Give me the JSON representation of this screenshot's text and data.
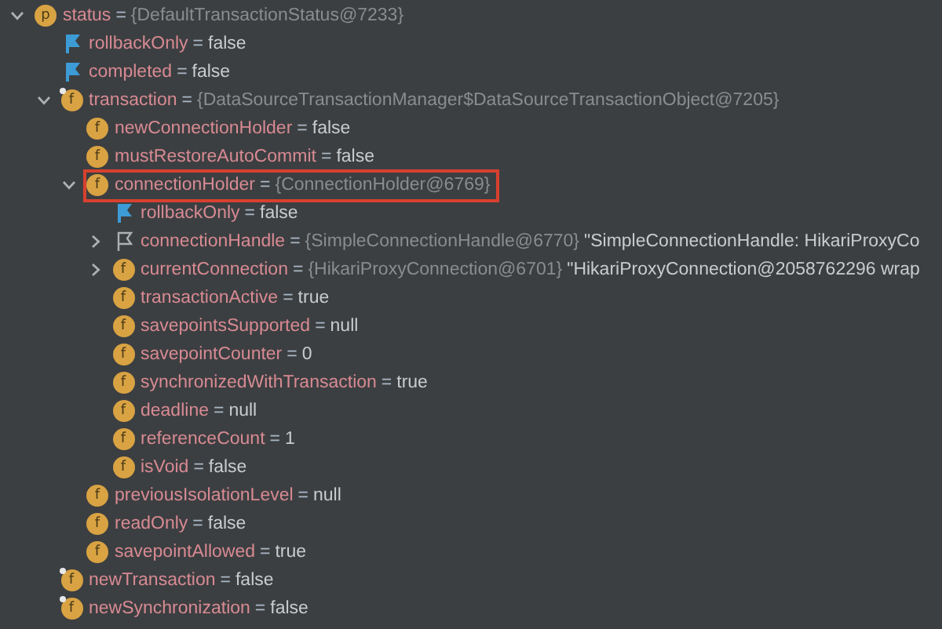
{
  "tree": [
    {
      "kind": "param",
      "badge": "p",
      "name": "status",
      "operator": "=",
      "ref": "{DefaultTransactionStatus@7233}",
      "expanded": true,
      "children": [
        {
          "kind": "flag",
          "name": "rollbackOnly",
          "operator": "=",
          "value": "false"
        },
        {
          "kind": "flag",
          "name": "completed",
          "operator": "=",
          "value": "false"
        },
        {
          "kind": "field-final",
          "badge": "f",
          "name": "transaction",
          "operator": "=",
          "ref": "{DataSourceTransactionManager$DataSourceTransactionObject@7205}",
          "expanded": true,
          "children": [
            {
              "kind": "field",
              "badge": "f",
              "name": "newConnectionHolder",
              "operator": "=",
              "value": "false"
            },
            {
              "kind": "field",
              "badge": "f",
              "name": "mustRestoreAutoCommit",
              "operator": "=",
              "value": "false"
            },
            {
              "kind": "field",
              "badge": "f",
              "name": "connectionHolder",
              "operator": "=",
              "ref": "{ConnectionHolder@6769}",
              "expanded": true,
              "highlighted": true,
              "children": [
                {
                  "kind": "flag",
                  "name": "rollbackOnly",
                  "operator": "=",
                  "value": "false"
                },
                {
                  "kind": "flag-outline",
                  "name": "connectionHandle",
                  "operator": "=",
                  "ref": "{SimpleConnectionHandle@6770}",
                  "detail": "\"SimpleConnectionHandle: HikariProxyCo",
                  "expanded": false
                },
                {
                  "kind": "field",
                  "badge": "f",
                  "name": "currentConnection",
                  "operator": "=",
                  "ref": "{HikariProxyConnection@6701}",
                  "detail": "\"HikariProxyConnection@2058762296 wrap",
                  "expanded": false
                },
                {
                  "kind": "field",
                  "badge": "f",
                  "name": "transactionActive",
                  "operator": "=",
                  "value": "true"
                },
                {
                  "kind": "field",
                  "badge": "f",
                  "name": "savepointsSupported",
                  "operator": "=",
                  "value": "null"
                },
                {
                  "kind": "field",
                  "badge": "f",
                  "name": "savepointCounter",
                  "operator": "=",
                  "value": "0"
                },
                {
                  "kind": "field",
                  "badge": "f",
                  "name": "synchronizedWithTransaction",
                  "operator": "=",
                  "value": "true"
                },
                {
                  "kind": "field",
                  "badge": "f",
                  "name": "deadline",
                  "operator": "=",
                  "value": "null"
                },
                {
                  "kind": "field",
                  "badge": "f",
                  "name": "referenceCount",
                  "operator": "=",
                  "value": "1"
                },
                {
                  "kind": "field",
                  "badge": "f",
                  "name": "isVoid",
                  "operator": "=",
                  "value": "false"
                }
              ]
            },
            {
              "kind": "field",
              "badge": "f",
              "name": "previousIsolationLevel",
              "operator": "=",
              "value": "null"
            },
            {
              "kind": "field",
              "badge": "f",
              "name": "readOnly",
              "operator": "=",
              "value": "false"
            },
            {
              "kind": "field",
              "badge": "f",
              "name": "savepointAllowed",
              "operator": "=",
              "value": "true"
            }
          ]
        },
        {
          "kind": "field-final",
          "badge": "f",
          "name": "newTransaction",
          "operator": "=",
          "value": "false"
        },
        {
          "kind": "field-final",
          "badge": "f",
          "name": "newSynchronization",
          "operator": "=",
          "value": "false"
        }
      ]
    }
  ]
}
